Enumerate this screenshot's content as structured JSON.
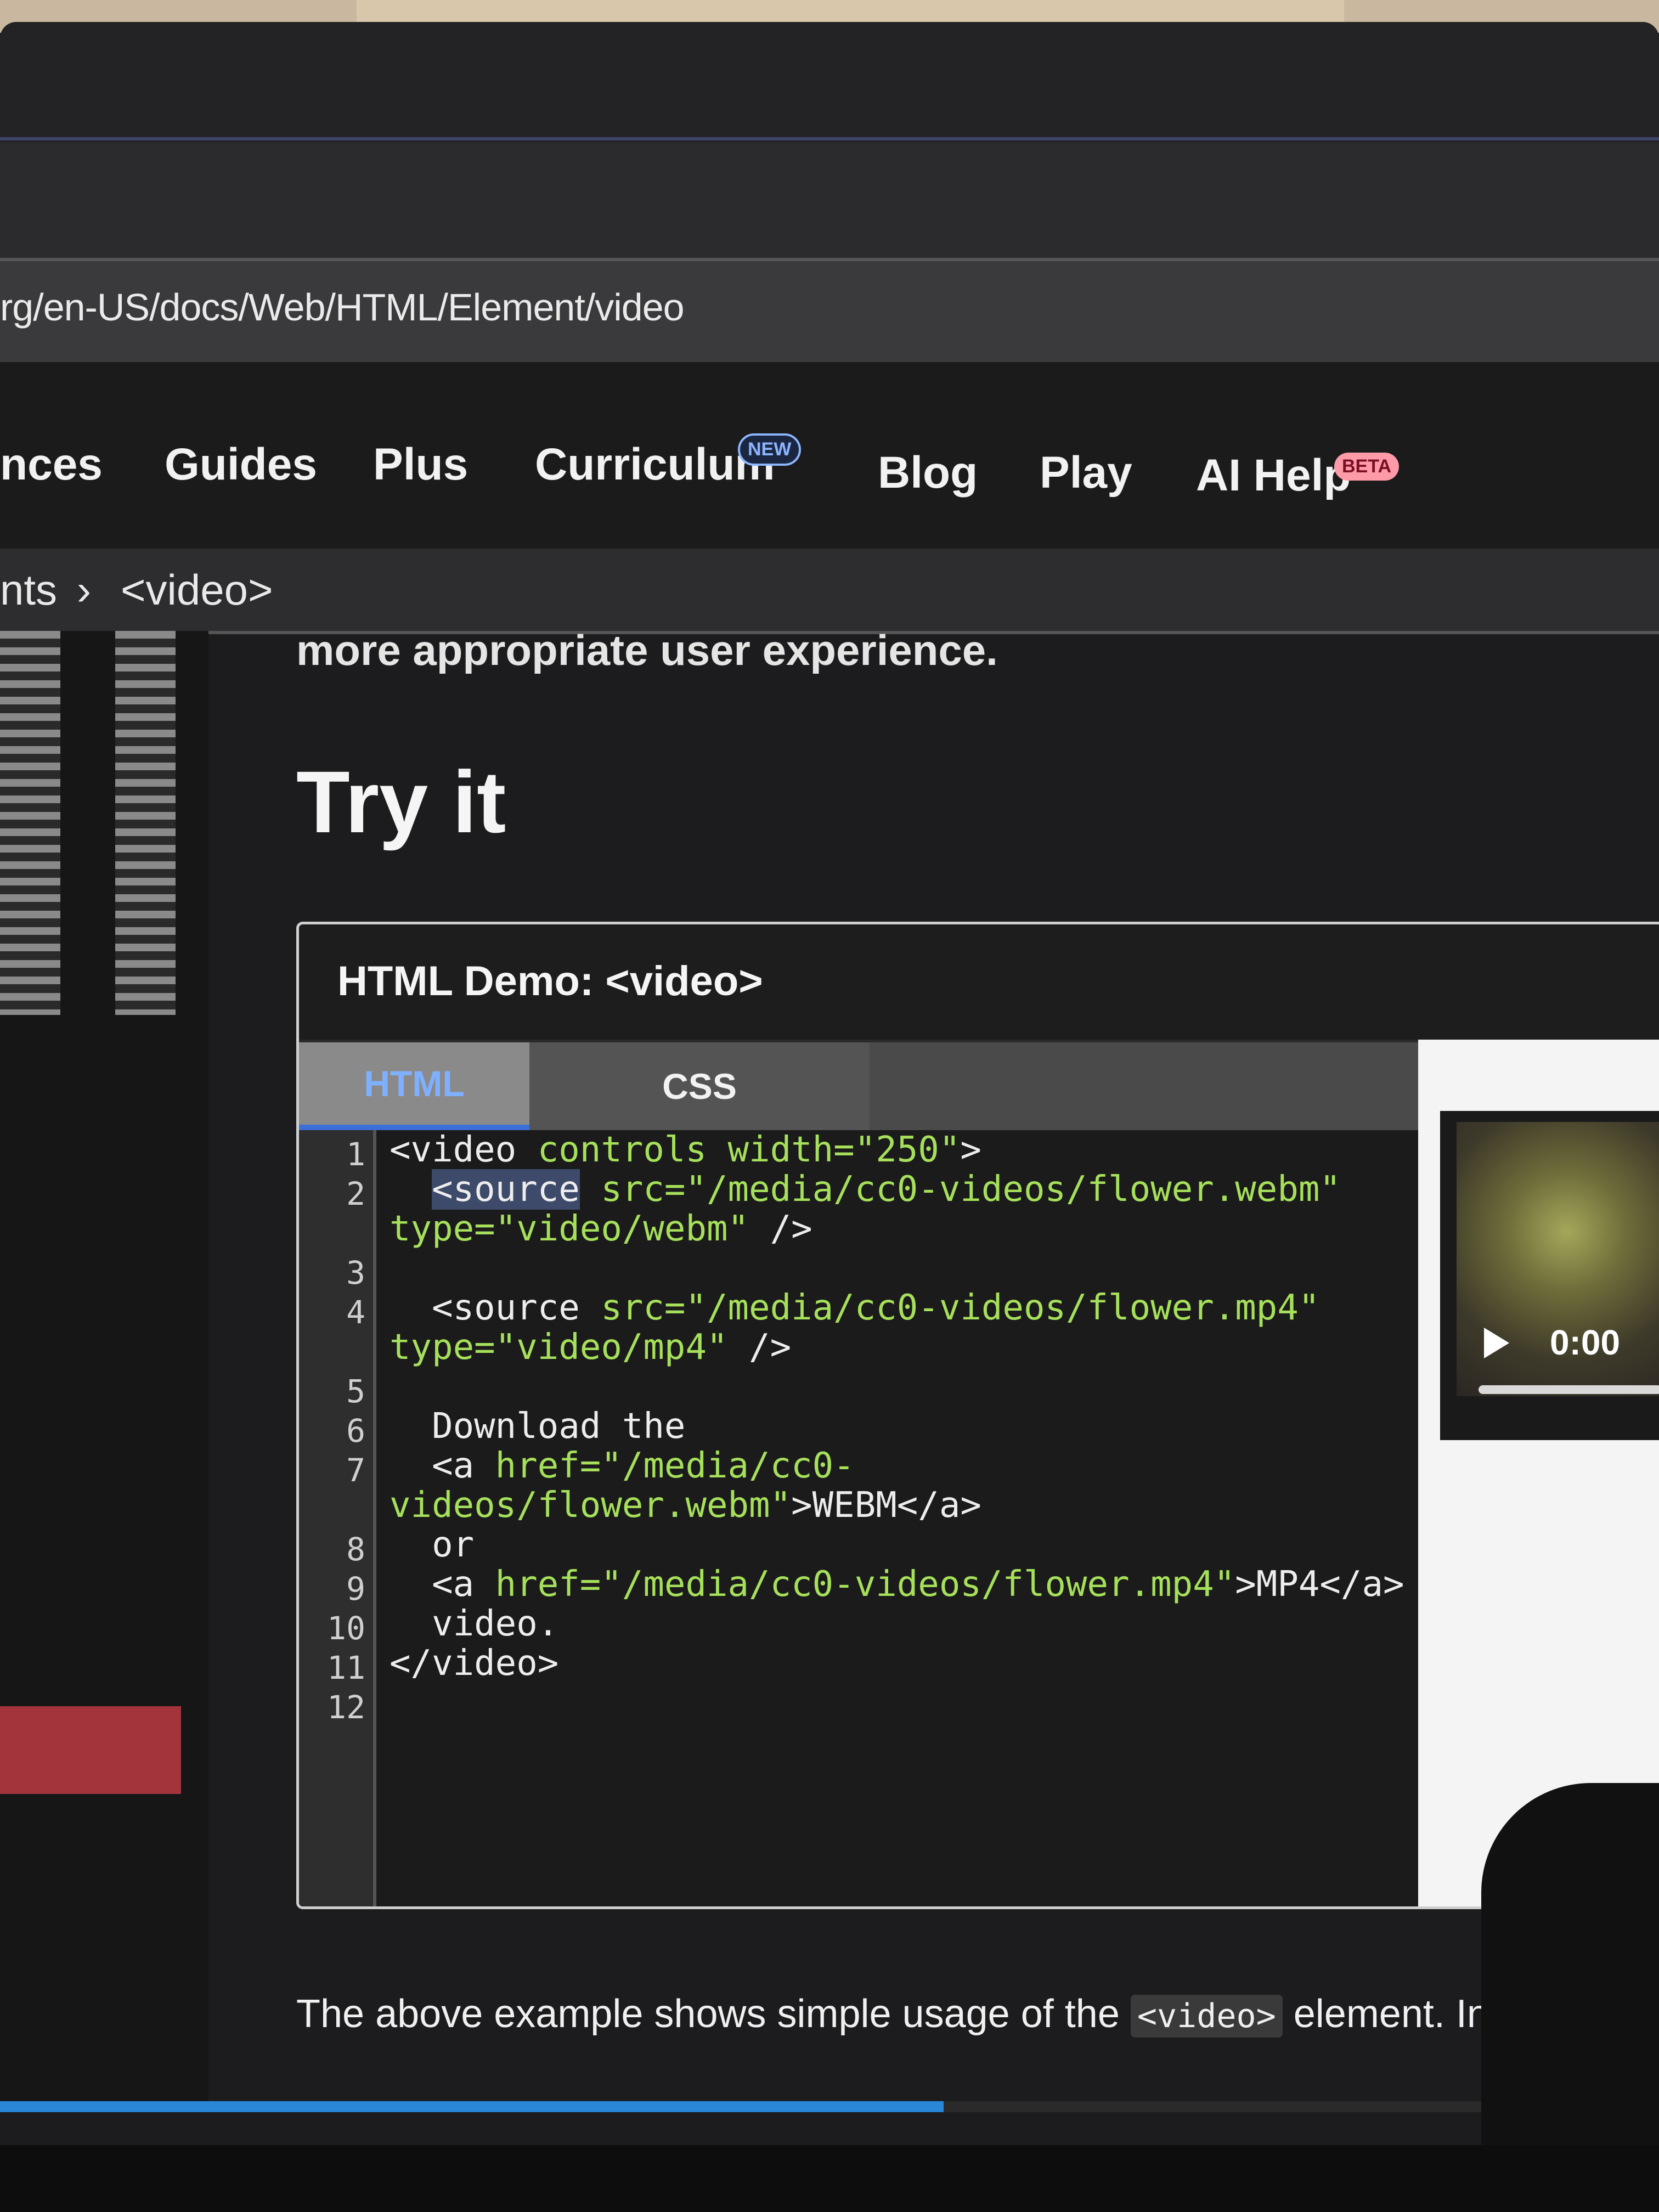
{
  "browser": {
    "url": "rg/en-US/docs/Web/HTML/Element/video"
  },
  "nav": {
    "items": [
      {
        "label": "nces"
      },
      {
        "label": "Guides"
      },
      {
        "label": "Plus"
      },
      {
        "label": "Curriculum",
        "badge": "NEW"
      },
      {
        "label": "Blog"
      },
      {
        "label": "Play"
      },
      {
        "label": "AI Help",
        "badge": "BETA"
      }
    ]
  },
  "breadcrumb": {
    "parent": "nts",
    "separator": "›",
    "current": "<video>"
  },
  "content": {
    "intro_tail": "more appropriate user experience.",
    "heading": "Try it",
    "demo": {
      "title": "HTML Demo: <video>",
      "tabs": [
        "HTML",
        "CSS"
      ],
      "line_numbers": [
        "1",
        "2",
        "3",
        "4",
        "5",
        "6",
        "7",
        "8",
        "9",
        "10",
        "11",
        "12"
      ],
      "preview": {
        "time": "0:00"
      }
    },
    "below": {
      "before": "The above example shows simple usage of the ",
      "code": "<video>",
      "after": " element. In"
    }
  },
  "colors": {
    "accent_tab": "#7fb0ff",
    "code_string": "#a6e05b",
    "beta_badge": "#ff9aa9",
    "new_badge": "#8cb4ff",
    "scroll_thumb": "#2a86d9"
  },
  "icons": {
    "play": "play-icon"
  }
}
